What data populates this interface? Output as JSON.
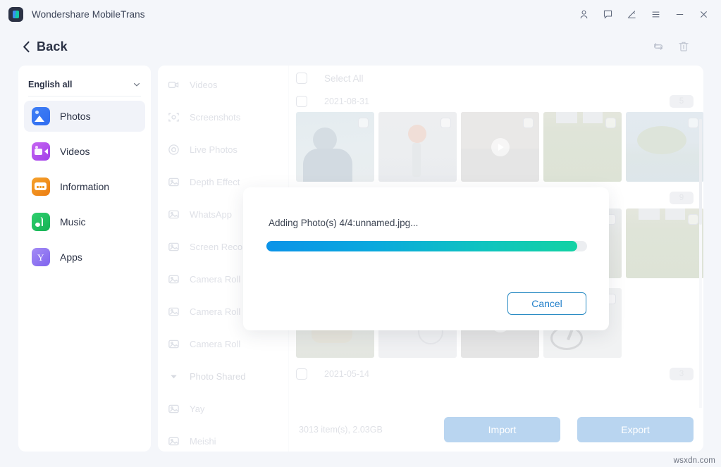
{
  "window": {
    "app_title": "Wondershare MobileTrans",
    "controls": [
      {
        "name": "account-icon",
        "label": "Account"
      },
      {
        "name": "feedback-icon",
        "label": "Feedback"
      },
      {
        "name": "edit-icon",
        "label": "Edit"
      },
      {
        "name": "menu-icon",
        "label": "Menu"
      },
      {
        "name": "minimize-icon",
        "label": "Minimize"
      },
      {
        "name": "close-icon",
        "label": "Close"
      }
    ]
  },
  "backbar": {
    "back_label": "Back",
    "refresh_label": "Refresh",
    "delete_label": "Delete"
  },
  "sidebar": {
    "language": "English all",
    "items": [
      {
        "label": "Photos",
        "icon": "photos-icon",
        "active": true
      },
      {
        "label": "Videos",
        "icon": "videos-icon",
        "active": false
      },
      {
        "label": "Information",
        "icon": "information-icon",
        "active": false
      },
      {
        "label": "Music",
        "icon": "music-icon",
        "active": false
      },
      {
        "label": "Apps",
        "icon": "apps-icon",
        "active": false
      }
    ]
  },
  "categories": [
    {
      "label": "Videos",
      "icon": "video-camera-icon",
      "type": "item"
    },
    {
      "label": "Screenshots",
      "icon": "screenshot-icon",
      "type": "item"
    },
    {
      "label": "Live Photos",
      "icon": "live-photo-icon",
      "type": "item"
    },
    {
      "label": "Depth Effect",
      "icon": "photo-icon",
      "type": "item"
    },
    {
      "label": "WhatsApp",
      "icon": "photo-icon",
      "type": "item"
    },
    {
      "label": "Screen Recorder",
      "icon": "photo-icon",
      "type": "item"
    },
    {
      "label": "Camera Roll",
      "icon": "photo-icon",
      "type": "item"
    },
    {
      "label": "Camera Roll",
      "icon": "photo-icon",
      "type": "item"
    },
    {
      "label": "Camera Roll",
      "icon": "photo-icon",
      "type": "item"
    },
    {
      "label": "Photo Shared",
      "icon": "caret-down-icon",
      "type": "group"
    },
    {
      "label": "Yay",
      "icon": "photo-icon",
      "type": "item"
    },
    {
      "label": "Meishi",
      "icon": "photo-icon",
      "type": "item"
    }
  ],
  "photos": {
    "select_all_label": "Select All",
    "groups": [
      {
        "date": "2021-08-31",
        "count": "5",
        "thumbs": [
          {
            "art": "t-person",
            "video": false
          },
          {
            "art": "t-flower",
            "video": false
          },
          {
            "art": "t-video",
            "video": true
          },
          {
            "art": "t-grass",
            "video": false
          },
          {
            "art": "t-palm",
            "video": false
          }
        ]
      },
      {
        "date": "",
        "count": "9",
        "thumbs": [
          {
            "art": "t-person",
            "video": false
          },
          {
            "art": "t-flower",
            "video": false
          },
          {
            "art": "t-video",
            "video": true
          },
          {
            "art": "t-tree",
            "video": false
          },
          {
            "art": "t-grass",
            "video": false
          }
        ]
      },
      {
        "date": "",
        "count": "",
        "thumbs": [
          {
            "art": "t-tree",
            "video": false
          },
          {
            "art": "t-rings",
            "video": false
          },
          {
            "art": "t-video",
            "video": true
          },
          {
            "art": "t-cable",
            "video": false
          }
        ]
      }
    ],
    "last_date": "2021-05-14",
    "last_count": "3"
  },
  "footer": {
    "count_text": "3013 item(s), 2.03GB",
    "import_label": "Import",
    "export_label": "Export"
  },
  "dialog": {
    "message": "Adding Photo(s) 4/4:unnamed.jpg...",
    "progress_percent": 97,
    "cancel_label": "Cancel"
  },
  "watermark": "wsxdn.com",
  "colors": {
    "page_bg": "#f4f6fa",
    "card_bg": "#ffffff",
    "accent_blue": "#1f7ec9",
    "progress_start": "#0b93e8",
    "progress_end": "#13d2a4",
    "button_disabled": "#b9d5f0"
  }
}
